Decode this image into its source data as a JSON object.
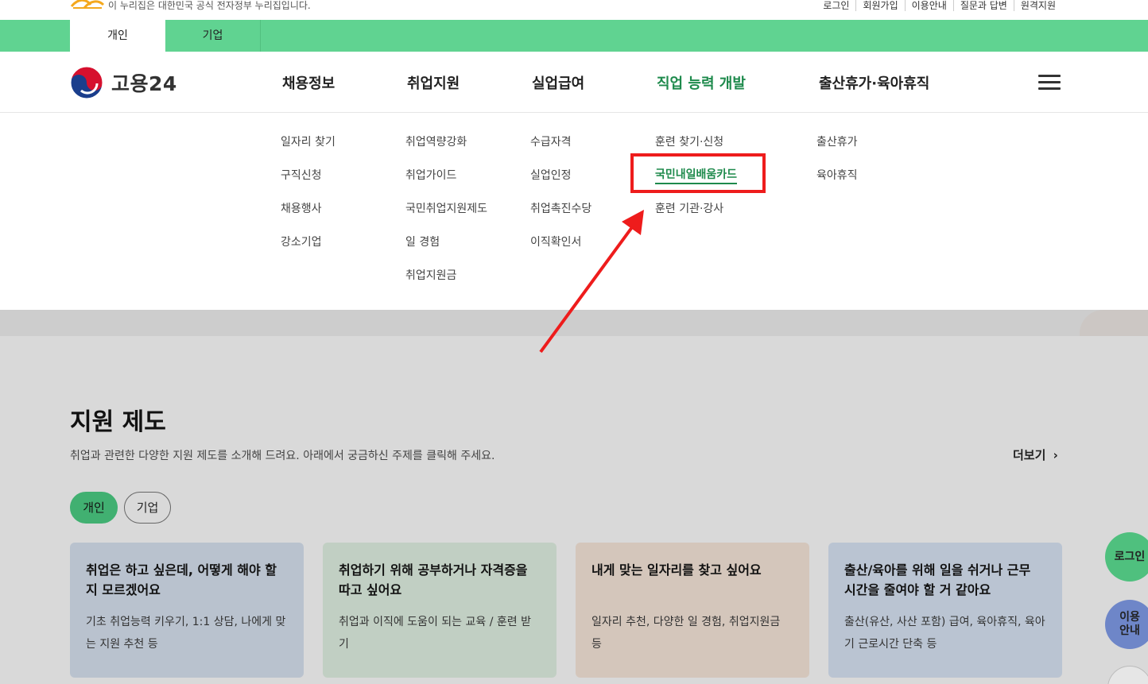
{
  "gov_bar": {
    "notice": "이 누리집은 대한민국 공식 전자정부 누리집입니다.",
    "util_links": [
      "로그인",
      "회원가입",
      "이용안내",
      "질문과 답변",
      "원격지원"
    ]
  },
  "user_tabs": [
    "개인",
    "기업"
  ],
  "logo": {
    "text": "고용24"
  },
  "gnb": [
    "채용정보",
    "취업지원",
    "실업급여",
    "직업 능력 개발",
    "출산휴가·육아휴직"
  ],
  "submenu": {
    "col1": [
      "일자리 찾기",
      "구직신청",
      "채용행사",
      "강소기업"
    ],
    "col2": [
      "취업역량강화",
      "취업가이드",
      "국민취업지원제도",
      "일 경험",
      "취업지원금"
    ],
    "col3": [
      "수급자격",
      "실업인정",
      "취업촉진수당",
      "이직확인서"
    ],
    "col4": [
      "훈련 찾기·신청",
      "국민내일배움카드",
      "훈련 기관·강사"
    ],
    "col5": [
      "출산휴가",
      "육아휴직"
    ]
  },
  "support": {
    "title": "지원 제도",
    "desc": "취업과 관련한 다양한 지원 제도를 소개해 드려요. 아래에서 궁금하신 주제를 클릭해 주세요.",
    "more": "더보기",
    "pills": [
      "개인",
      "기업"
    ],
    "cards": [
      {
        "title": "취업은 하고 싶은데, 어떻게 해야 할 지 모르겠어요",
        "desc": "기초 취업능력 키우기, 1:1 상담, 나에게 맞는 지원 추천 등"
      },
      {
        "title": "취업하기 위해 공부하거나 자격증을 따고 싶어요",
        "desc": "취업과 이직에 도움이 되는 교육 / 훈련 받기"
      },
      {
        "title": "내게 맞는 일자리를 찾고 싶어요",
        "desc": "일자리 추천, 다양한 일 경험, 취업지원금 등"
      },
      {
        "title": "출산/육아를 위해 일을 쉬거나 근무 시간을 줄여야 할 거 같아요",
        "desc": "출산(유산, 사산 포함) 급여, 육아휴직, 육아기 근로시간 단축 등"
      }
    ]
  },
  "floating": {
    "login": "로그인",
    "guide_line1": "이용",
    "guide_line2": "안내"
  },
  "colors": {
    "green_bar": "#60d391",
    "accent_green": "#1e8a4c",
    "highlight_red": "#ee1c1c"
  }
}
